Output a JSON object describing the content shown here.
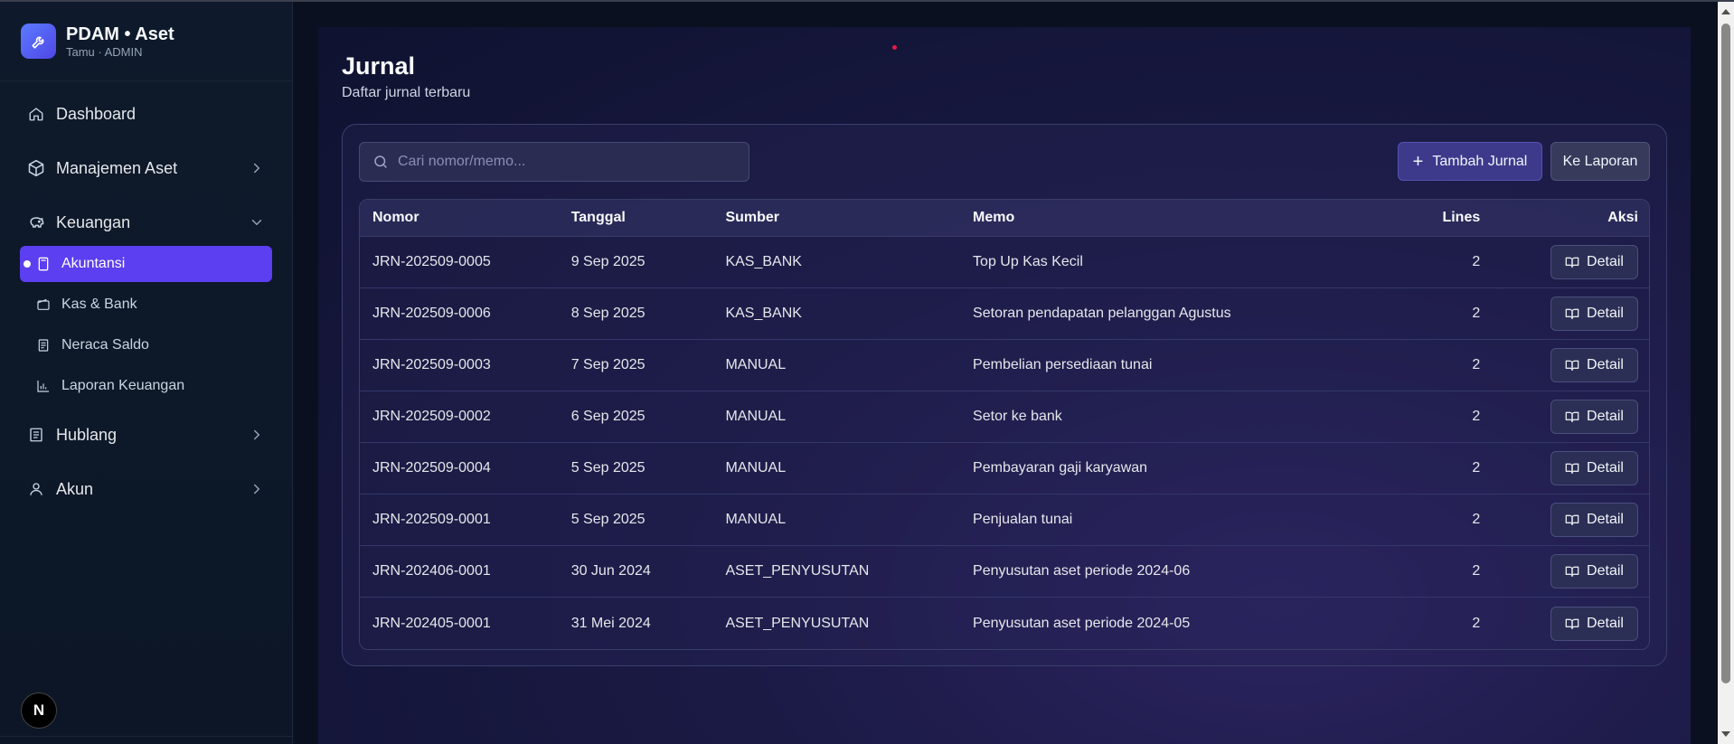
{
  "brand": {
    "title": "PDAM • Aset",
    "subtitle": "Tamu · ADMIN"
  },
  "sidebar": {
    "items": [
      {
        "label": "Dashboard"
      },
      {
        "label": "Manajemen Aset"
      },
      {
        "label": "Keuangan"
      },
      {
        "label": "Hublang"
      },
      {
        "label": "Akun"
      }
    ],
    "keuangan_sub": [
      {
        "label": "Akuntansi"
      },
      {
        "label": "Kas & Bank"
      },
      {
        "label": "Neraca Saldo"
      },
      {
        "label": "Laporan Keuangan"
      }
    ],
    "badge": "N"
  },
  "page": {
    "title": "Jurnal",
    "subtitle": "Daftar jurnal terbaru"
  },
  "toolbar": {
    "search_placeholder": "Cari nomor/memo...",
    "add_label": "Tambah Jurnal",
    "report_label": "Ke Laporan"
  },
  "table": {
    "headers": {
      "nomor": "Nomor",
      "tanggal": "Tanggal",
      "sumber": "Sumber",
      "memo": "Memo",
      "lines": "Lines",
      "aksi": "Aksi"
    },
    "detail_label": "Detail",
    "rows": [
      {
        "nomor": "JRN-202509-0005",
        "tanggal": "9 Sep 2025",
        "sumber": "KAS_BANK",
        "memo": "Top Up Kas Kecil",
        "lines": "2"
      },
      {
        "nomor": "JRN-202509-0006",
        "tanggal": "8 Sep 2025",
        "sumber": "KAS_BANK",
        "memo": "Setoran pendapatan pelanggan Agustus",
        "lines": "2"
      },
      {
        "nomor": "JRN-202509-0003",
        "tanggal": "7 Sep 2025",
        "sumber": "MANUAL",
        "memo": "Pembelian persediaan tunai",
        "lines": "2"
      },
      {
        "nomor": "JRN-202509-0002",
        "tanggal": "6 Sep 2025",
        "sumber": "MANUAL",
        "memo": "Setor ke bank",
        "lines": "2"
      },
      {
        "nomor": "JRN-202509-0004",
        "tanggal": "5 Sep 2025",
        "sumber": "MANUAL",
        "memo": "Pembayaran gaji karyawan",
        "lines": "2"
      },
      {
        "nomor": "JRN-202509-0001",
        "tanggal": "5 Sep 2025",
        "sumber": "MANUAL",
        "memo": "Penjualan tunai",
        "lines": "2"
      },
      {
        "nomor": "JRN-202406-0001",
        "tanggal": "30 Jun 2024",
        "sumber": "ASET_PENYUSUTAN",
        "memo": "Penyusutan aset periode 2024-06",
        "lines": "2"
      },
      {
        "nomor": "JRN-202405-0001",
        "tanggal": "31 Mei 2024",
        "sumber": "ASET_PENYUSUTAN",
        "memo": "Penyusutan aset periode 2024-05",
        "lines": "2"
      }
    ]
  },
  "colors": {
    "accent": "#5b3ff0",
    "brand": "#4f46e5"
  }
}
